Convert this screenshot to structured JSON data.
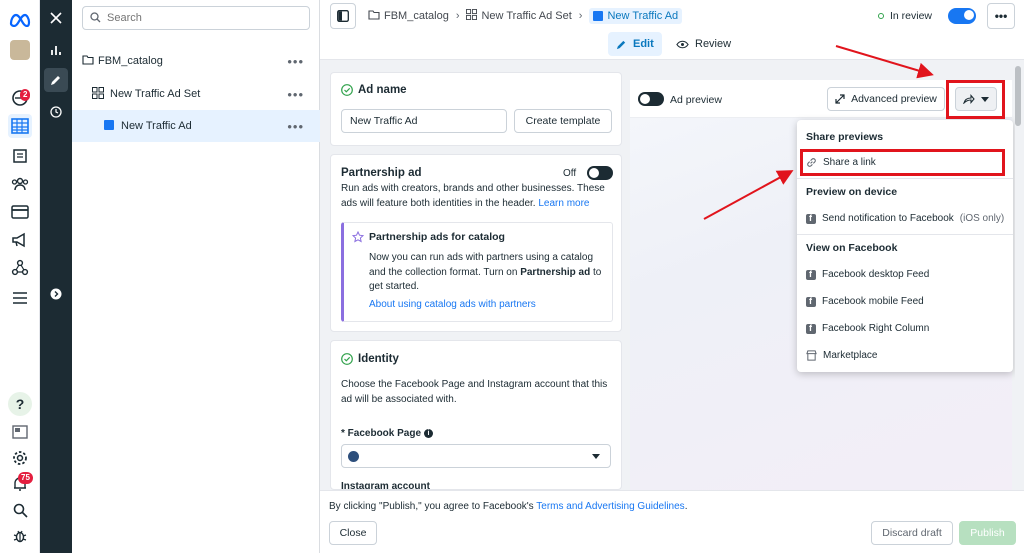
{
  "tree": {
    "search_placeholder": "Search",
    "items": [
      {
        "label": "FBM_catalog",
        "more": "•••"
      },
      {
        "label": "New Traffic Ad Set",
        "more": "•••"
      },
      {
        "label": "New Traffic Ad",
        "more": "•••"
      }
    ]
  },
  "rail": {
    "notif_badge": "2",
    "alerts_badge": "75",
    "help": "?"
  },
  "header": {
    "breadcrumbs": [
      "FBM_catalog",
      "New Traffic Ad Set",
      "New Traffic Ad"
    ],
    "status": "In review",
    "more": "•••",
    "edit_label": "Edit",
    "review_label": "Review"
  },
  "ad_name": {
    "title": "Ad name",
    "value": "New Traffic Ad",
    "create_template": "Create template"
  },
  "partnership": {
    "title": "Partnership ad",
    "toggle_state": "Off",
    "description": "Run ads with creators, brands and other businesses. These ads will feature both identities in the header.",
    "learn_more": "Learn more",
    "catalog_title": "Partnership ads for catalog",
    "catalog_text_1": "Now you can run ads with partners using a catalog and the collection format. Turn on ",
    "catalog_bold": "Partnership ad",
    "catalog_text_2": " to get started.",
    "catalog_link": "About using catalog ads with partners"
  },
  "identity": {
    "title": "Identity",
    "description": "Choose the Facebook Page and Instagram account that this ad will be associated with.",
    "facebook_page_label": "* Facebook Page",
    "instagram_label": "Instagram account"
  },
  "preview": {
    "label": "Ad preview",
    "advanced_button": "Advanced preview"
  },
  "share_menu": {
    "section_1": "Share previews",
    "share_link": "Share a link",
    "section_2": "Preview on device",
    "send_notification": "Send notification to Facebook",
    "ios_only": "(iOS only)",
    "section_3": "View on Facebook",
    "desktop_feed": "Facebook desktop Feed",
    "mobile_feed": "Facebook mobile Feed",
    "right_column": "Facebook Right Column",
    "marketplace": "Marketplace"
  },
  "footer": {
    "agreement_prefix": "By clicking \"Publish,\" you agree to Facebook's ",
    "agreement_link": "Terms and Advertising Guidelines",
    "agreement_suffix": ".",
    "close": "Close",
    "discard": "Discard draft",
    "publish": "Publish"
  },
  "colors": {
    "accent": "#1877f2",
    "annotation_red": "#e1141c",
    "nav_dark": "#1c2b33",
    "status_green": "#31a24c"
  }
}
